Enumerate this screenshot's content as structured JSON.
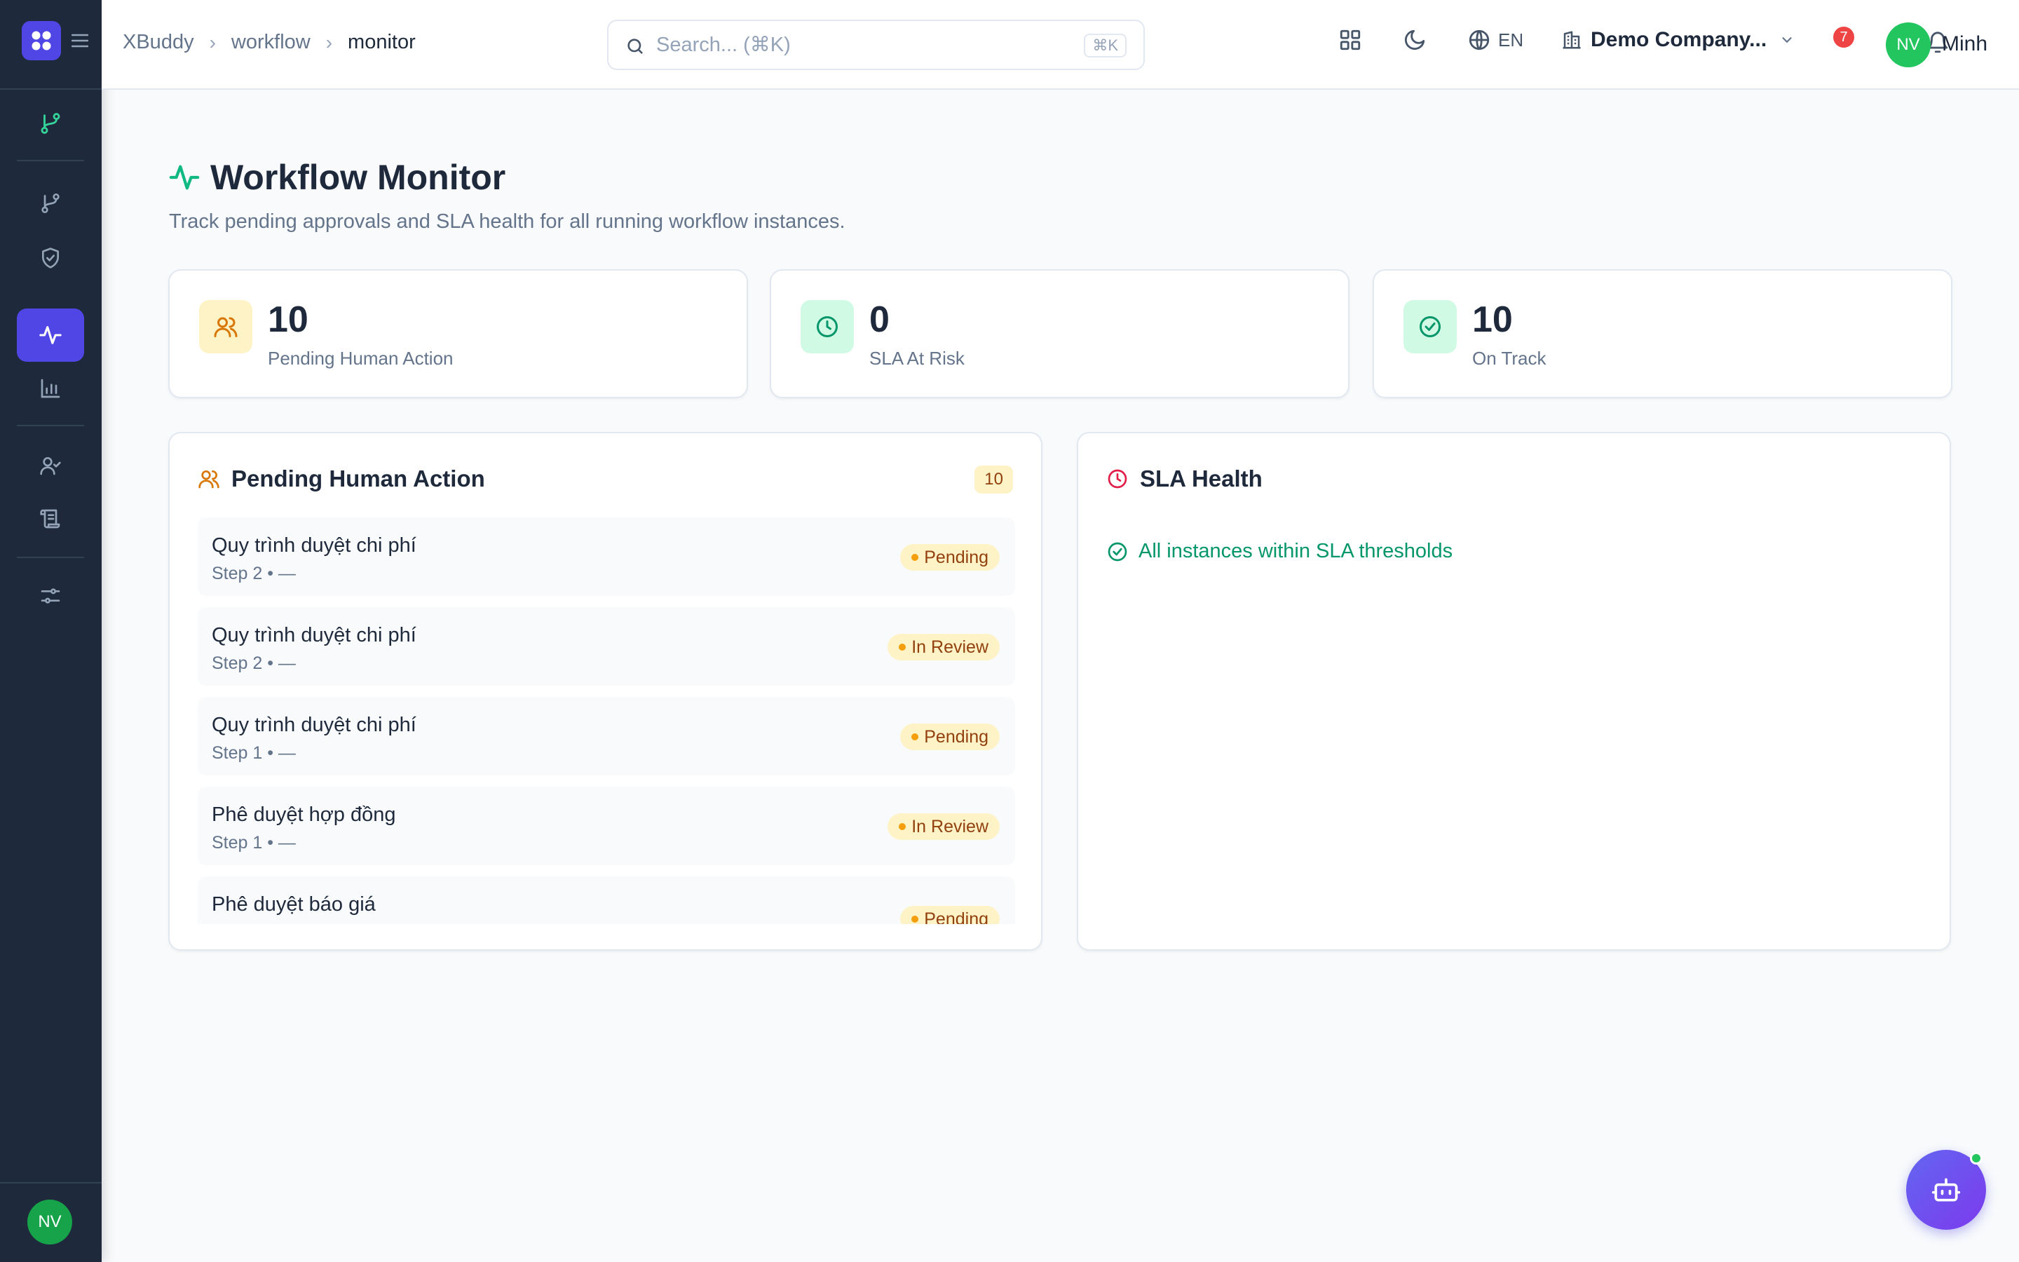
{
  "header": {
    "breadcrumb": [
      "XBuddy",
      "workflow",
      "monitor"
    ],
    "search_placeholder": "Search... (⌘K)",
    "search_shortcut": "⌘K",
    "language": "EN",
    "company": "Demo Company...",
    "notification_count": "7",
    "user_initials": "NV",
    "user_name": "Minh"
  },
  "sidebar": {
    "user_initials": "NV",
    "icons": [
      "workflow-icon",
      "workflow-icon",
      "shield-check-icon",
      "activity-icon",
      "bar-chart-icon",
      "user-check-icon",
      "scroll-icon",
      "sliders-icon"
    ]
  },
  "page": {
    "title": "Workflow Monitor",
    "subtitle": "Track pending approvals and SLA health for all running workflow instances."
  },
  "stats": [
    {
      "value": "10",
      "label": "Pending Human Action",
      "icon": "users-icon",
      "color": "#d97706"
    },
    {
      "value": "0",
      "label": "SLA At Risk",
      "icon": "clock-icon",
      "color": "#059669"
    },
    {
      "value": "10",
      "label": "On Track",
      "icon": "check-circle-icon",
      "color": "#059669"
    }
  ],
  "pending": {
    "title": "Pending Human Action",
    "count": "10",
    "items": [
      {
        "name": "Quy trình duyệt chi phí",
        "meta": "Step 2 • —",
        "status": "Pending"
      },
      {
        "name": "Quy trình duyệt chi phí",
        "meta": "Step 2 • —",
        "status": "In Review"
      },
      {
        "name": "Quy trình duyệt chi phí",
        "meta": "Step 1 • —",
        "status": "Pending"
      },
      {
        "name": "Phê duyệt hợp đồng",
        "meta": "Step 1 • —",
        "status": "In Review"
      },
      {
        "name": "Phê duyệt báo giá",
        "meta": "",
        "status": "Pending"
      }
    ]
  },
  "sla": {
    "title": "SLA Health",
    "message": "All instances within SLA thresholds"
  },
  "colors": {
    "accent": "#4f46e5",
    "sidebar": "#1e293b",
    "success": "#059669",
    "warning": "#f59e0b",
    "danger": "#e11d48"
  }
}
